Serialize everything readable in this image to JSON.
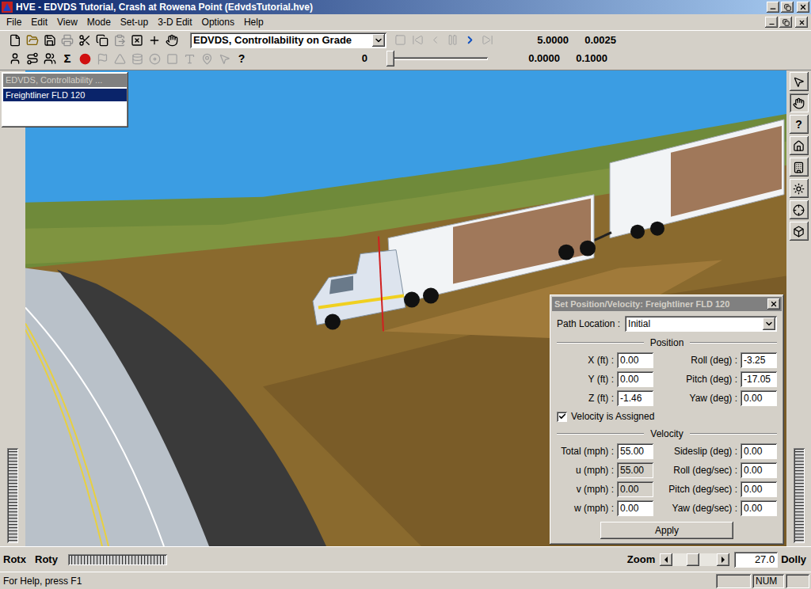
{
  "window": {
    "title": "HVE - EDVDS Tutorial, Crash at Rowena Point (EdvdsTutorial.hve)"
  },
  "menu": [
    "File",
    "Edit",
    "View",
    "Mode",
    "Set-up",
    "3-D Edit",
    "Options",
    "Help"
  ],
  "toolbar": {
    "event_select": "EDVDS, Controllability on Grade",
    "playback": [
      {
        "kind": "stop",
        "disabled": true
      },
      {
        "kind": "first",
        "disabled": true
      },
      {
        "kind": "back",
        "disabled": true
      },
      {
        "kind": "pause",
        "disabled": true
      },
      {
        "kind": "forward",
        "disabled": false
      },
      {
        "kind": "last",
        "disabled": true
      }
    ],
    "end_time": "5.0000",
    "time_step": "0.0025",
    "frame": "0",
    "time_level": 0,
    "current_time": "0.0000",
    "output_interval": "0.1000",
    "sigma": "Σ",
    "help": "?"
  },
  "event_window": {
    "title": "EDVDS, Controllability ...",
    "items": [
      {
        "label": "Freightliner FLD 120",
        "selected": true
      }
    ]
  },
  "right_toolbar": {
    "help": "?"
  },
  "dialog": {
    "title": "Set Position/Velocity: Freightliner FLD 120",
    "path_label": "Path Location :",
    "path_value": "Initial",
    "position_header": "Position",
    "position_fields": [
      {
        "label": "X (ft) :",
        "value": "0.00",
        "disabled": false
      },
      {
        "label": "Roll (deg) :",
        "value": "-3.25",
        "disabled": false
      },
      {
        "label": "Y (ft) :",
        "value": "0.00",
        "disabled": false
      },
      {
        "label": "Pitch (deg) :",
        "value": "-17.05",
        "disabled": false
      },
      {
        "label": "Z (ft) :",
        "value": "-1.46",
        "disabled": false
      },
      {
        "label": "Yaw (deg) :",
        "value": "0.00",
        "disabled": false
      }
    ],
    "velocity_assigned": {
      "label": "Velocity is Assigned",
      "checked": true
    },
    "velocity_header": "Velocity",
    "velocity_fields": [
      {
        "label": "Total (mph) :",
        "value": "55.00",
        "disabled": false
      },
      {
        "label": "Sideslip (deg) :",
        "value": "0.00",
        "disabled": false
      },
      {
        "label": "u (mph) :",
        "value": "55.00",
        "disabled": true
      },
      {
        "label": "Roll (deg/sec) :",
        "value": "0.00",
        "disabled": false
      },
      {
        "label": "v (mph) :",
        "value": "0.00",
        "disabled": true
      },
      {
        "label": "Pitch (deg/sec) :",
        "value": "0.00",
        "disabled": false
      },
      {
        "label": "w (mph) :",
        "value": "0.00",
        "disabled": false
      },
      {
        "label": "Yaw (deg/sec) :",
        "value": "0.00",
        "disabled": false
      }
    ],
    "apply": "Apply"
  },
  "view_controls": {
    "rotx": "Rotx",
    "roty": "Roty",
    "zoom": "Zoom",
    "zoom_level": 0.45,
    "zoom_value": "27.0",
    "dolly": "Dolly"
  },
  "status_bar": {
    "help": "For Help, press F1",
    "indicators": [
      "NUM"
    ]
  }
}
